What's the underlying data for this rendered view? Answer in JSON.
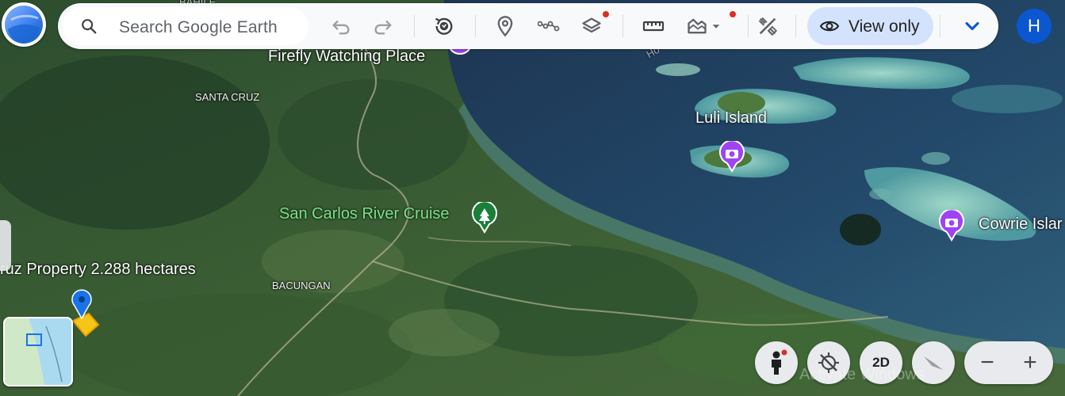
{
  "toolbar": {
    "search_placeholder": "Search Google Earth",
    "view_only_label": "View only",
    "avatar_initial": "H",
    "buttons": [
      "undo-icon",
      "redo-icon",
      "history-icon",
      "place-icon",
      "path-icon",
      "layers-icon",
      "ruler-icon",
      "terrain-icon",
      "chevron-down-icon",
      "tools-icon",
      "eye-icon",
      "expand-icon"
    ]
  },
  "map": {
    "labels": {
      "firefly": "Firefly Watching Place",
      "santa_cruz": "SANTA CRUZ",
      "luli": "Luli Island",
      "river_cruise": "San Carlos River Cruise",
      "cowrie": "Cowrie Islar",
      "property": "ruz Property 2.288 hectares",
      "bacungan": "BACUNGAN",
      "bahile": "BAHILE",
      "road_fragment": "Ho"
    }
  },
  "controls": {
    "twod_label": "2D",
    "zoom_out": "−",
    "zoom_in": "+"
  },
  "watermark": "Activate Windows",
  "colors": {
    "toolbar_bg": "#f8f9fa",
    "view_only_bg": "#d3e3fd",
    "avatar_bg": "#0b57d0",
    "poi_purple": "#a142f4",
    "poi_green": "#188038",
    "pin_blue": "#1a73e8",
    "notification_dot": "#d93025"
  }
}
